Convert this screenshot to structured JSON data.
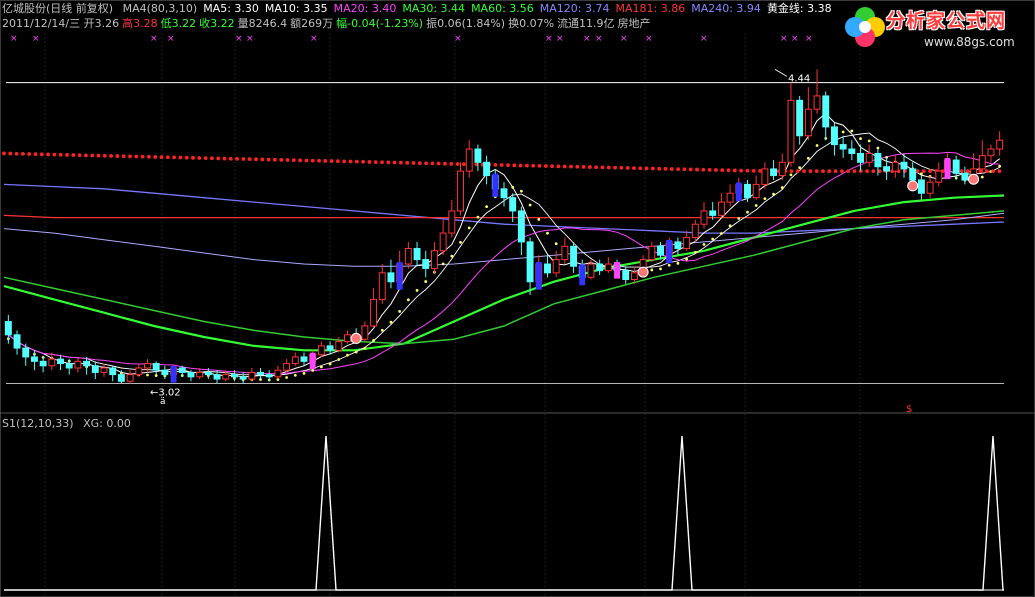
{
  "header": {
    "stock": "亿城股份(日线 前复权)",
    "indicators": [
      {
        "text": "MA4(80,3,10)",
        "color": "#c0c0c0"
      },
      {
        "text": "MA5: 3.30",
        "color": "#ffffff"
      },
      {
        "text": "MA10: 3.35",
        "color": "#ffffff"
      },
      {
        "text": "MA20: 3.40",
        "color": "#ff44ff"
      },
      {
        "text": "MA30: 3.44",
        "color": "#33ff33"
      },
      {
        "text": "MA60: 3.56",
        "color": "#33ff33"
      },
      {
        "text": "MA120: 3.74",
        "color": "#8888ff"
      },
      {
        "text": "MA181: 3.86",
        "color": "#ff3333"
      },
      {
        "text": "MA240: 3.94",
        "color": "#8888ff"
      },
      {
        "text": "黄金线: 3.38",
        "color": "#ffffff"
      }
    ],
    "quote_date": "2011/12/14/三",
    "quote": [
      {
        "text": "开3.26",
        "color": "#c0c0c0"
      },
      {
        "text": "高3.28",
        "color": "#ff3333"
      },
      {
        "text": "低3.22",
        "color": "#33ff33"
      },
      {
        "text": "收3.22",
        "color": "#33ff33"
      },
      {
        "text": "量8246.4",
        "color": "#c0c0c0"
      },
      {
        "text": "额269万",
        "color": "#c0c0c0"
      },
      {
        "text": "幅-0.04(-1.23%)",
        "color": "#33ff33"
      },
      {
        "text": "振0.06(1.84%)",
        "color": "#c0c0c0"
      },
      {
        "text": "换0.07%",
        "color": "#c0c0c0"
      },
      {
        "text": "流通11.9亿",
        "color": "#c0c0c0"
      },
      {
        "text": "房地产",
        "color": "#c0c0c0"
      }
    ]
  },
  "sub_header": {
    "formula": "S1(12,10,33)",
    "xg": "XG: 0.00"
  },
  "logo": {
    "brand": "分析家公式网",
    "url": "www.88gs.com"
  },
  "colors": {
    "up": "#ff3333",
    "down": "#54ffff",
    "buy": "#ff44ff",
    "sell": "#3333ff",
    "dots": "#ff2222",
    "gold": "#ffff66"
  },
  "chart_data": {
    "type": "candlestick",
    "ylim": [
      2.9,
      4.6
    ],
    "high_label": "4.44",
    "low_label": "3.02",
    "ma_labels": [
      "MA5",
      "MA10",
      "MA20",
      "MA30",
      "MA60",
      "MA120",
      "MA181",
      "MA240",
      "黄金线"
    ],
    "candles": [
      [
        3.3,
        3.24,
        3.33,
        3.2
      ],
      [
        3.24,
        3.18,
        3.26,
        3.15
      ],
      [
        3.18,
        3.14,
        3.2,
        3.1
      ],
      [
        3.14,
        3.12,
        3.17,
        3.08
      ],
      [
        3.12,
        3.1,
        3.14,
        3.07
      ],
      [
        3.1,
        3.13,
        3.16,
        3.08
      ],
      [
        3.13,
        3.11,
        3.15,
        3.08
      ],
      [
        3.11,
        3.09,
        3.13,
        3.06
      ],
      [
        3.09,
        3.12,
        3.14,
        3.07
      ],
      [
        3.12,
        3.1,
        3.14,
        3.06
      ],
      [
        3.1,
        3.07,
        3.12,
        3.04
      ],
      [
        3.07,
        3.09,
        3.11,
        3.05
      ],
      [
        3.09,
        3.06,
        3.1,
        3.03
      ],
      [
        3.06,
        3.03,
        3.08,
        3.02
      ],
      [
        3.03,
        3.06,
        3.08,
        3.02
      ],
      [
        3.06,
        3.09,
        3.11,
        3.05
      ],
      [
        3.09,
        3.11,
        3.13,
        3.07
      ],
      [
        3.11,
        3.08,
        3.12,
        3.06
      ],
      [
        3.08,
        3.06,
        3.1,
        3.04
      ],
      [
        3.06,
        3.09,
        3.1,
        3.05
      ],
      [
        3.09,
        3.07,
        3.1,
        3.05
      ],
      [
        3.07,
        3.05,
        3.08,
        3.03
      ],
      [
        3.05,
        3.07,
        3.09,
        3.04
      ],
      [
        3.07,
        3.06,
        3.09,
        3.04
      ],
      [
        3.06,
        3.04,
        3.08,
        3.02
      ],
      [
        3.04,
        3.06,
        3.08,
        3.03
      ],
      [
        3.06,
        3.05,
        3.08,
        3.03
      ],
      [
        3.05,
        3.04,
        3.07,
        3.02
      ],
      [
        3.04,
        3.07,
        3.09,
        3.03
      ],
      [
        3.07,
        3.06,
        3.09,
        3.04
      ],
      [
        3.06,
        3.05,
        3.08,
        3.03
      ],
      [
        3.05,
        3.08,
        3.1,
        3.04
      ],
      [
        3.08,
        3.11,
        3.13,
        3.07
      ],
      [
        3.11,
        3.14,
        3.16,
        3.1
      ],
      [
        3.14,
        3.12,
        3.16,
        3.1
      ],
      [
        3.12,
        3.15,
        3.17,
        3.11
      ],
      [
        3.15,
        3.19,
        3.21,
        3.14
      ],
      [
        3.19,
        3.17,
        3.21,
        3.15
      ],
      [
        3.17,
        3.21,
        3.23,
        3.16
      ],
      [
        3.21,
        3.24,
        3.26,
        3.2
      ],
      [
        3.24,
        3.22,
        3.27,
        3.21
      ],
      [
        3.22,
        3.28,
        3.3,
        3.21
      ],
      [
        3.28,
        3.4,
        3.45,
        3.27
      ],
      [
        3.4,
        3.52,
        3.56,
        3.38
      ],
      [
        3.52,
        3.48,
        3.58,
        3.45
      ],
      [
        3.48,
        3.56,
        3.62,
        3.46
      ],
      [
        3.56,
        3.63,
        3.66,
        3.54
      ],
      [
        3.63,
        3.58,
        3.66,
        3.55
      ],
      [
        3.58,
        3.54,
        3.62,
        3.5
      ],
      [
        3.54,
        3.62,
        3.66,
        3.52
      ],
      [
        3.62,
        3.7,
        3.76,
        3.6
      ],
      [
        3.7,
        3.8,
        3.85,
        3.68
      ],
      [
        3.8,
        3.98,
        4.02,
        3.78
      ],
      [
        3.98,
        4.08,
        4.12,
        3.95
      ],
      [
        4.08,
        4.02,
        4.1,
        3.98
      ],
      [
        4.02,
        3.96,
        4.05,
        3.92
      ],
      [
        3.96,
        3.9,
        3.99,
        3.86
      ],
      [
        3.9,
        3.86,
        3.93,
        3.82
      ],
      [
        3.86,
        3.8,
        3.88,
        3.75
      ],
      [
        3.8,
        3.66,
        3.82,
        3.6
      ],
      [
        3.66,
        3.48,
        3.68,
        3.42
      ],
      [
        3.48,
        3.56,
        3.6,
        3.46
      ],
      [
        3.56,
        3.52,
        3.6,
        3.5
      ],
      [
        3.52,
        3.58,
        3.62,
        3.5
      ],
      [
        3.58,
        3.64,
        3.68,
        3.56
      ],
      [
        3.64,
        3.55,
        3.66,
        3.52
      ],
      [
        3.55,
        3.5,
        3.58,
        3.48
      ],
      [
        3.5,
        3.56,
        3.58,
        3.49
      ],
      [
        3.56,
        3.53,
        3.58,
        3.51
      ],
      [
        3.53,
        3.56,
        3.59,
        3.52
      ],
      [
        3.56,
        3.53,
        3.58,
        3.51
      ],
      [
        3.53,
        3.49,
        3.55,
        3.47
      ],
      [
        3.49,
        3.52,
        3.55,
        3.47
      ],
      [
        3.52,
        3.58,
        3.6,
        3.51
      ],
      [
        3.58,
        3.64,
        3.66,
        3.57
      ],
      [
        3.64,
        3.6,
        3.66,
        3.58
      ],
      [
        3.6,
        3.66,
        3.68,
        3.59
      ],
      [
        3.66,
        3.63,
        3.68,
        3.6
      ],
      [
        3.63,
        3.68,
        3.71,
        3.62
      ],
      [
        3.68,
        3.74,
        3.76,
        3.66
      ],
      [
        3.74,
        3.8,
        3.84,
        3.72
      ],
      [
        3.8,
        3.78,
        3.84,
        3.76
      ],
      [
        3.78,
        3.84,
        3.88,
        3.77
      ],
      [
        3.84,
        3.88,
        3.92,
        3.82
      ],
      [
        3.88,
        3.92,
        3.95,
        3.86
      ],
      [
        3.92,
        3.86,
        3.94,
        3.84
      ],
      [
        3.86,
        3.92,
        3.96,
        3.85
      ],
      [
        3.92,
        3.99,
        4.02,
        3.9
      ],
      [
        3.99,
        3.96,
        4.03,
        3.94
      ],
      [
        3.96,
        4.02,
        4.06,
        3.94
      ],
      [
        4.02,
        4.3,
        4.38,
        4.0
      ],
      [
        4.3,
        4.14,
        4.32,
        4.1
      ],
      [
        4.14,
        4.26,
        4.36,
        4.12
      ],
      [
        4.26,
        4.32,
        4.44,
        4.24
      ],
      [
        4.32,
        4.18,
        4.34,
        4.12
      ],
      [
        4.18,
        4.1,
        4.2,
        4.05
      ],
      [
        4.1,
        4.08,
        4.14,
        4.04
      ],
      [
        4.08,
        4.06,
        4.12,
        4.03
      ],
      [
        4.06,
        4.02,
        4.1,
        3.98
      ],
      [
        4.02,
        4.06,
        4.1,
        4.0
      ],
      [
        4.06,
        4.0,
        4.08,
        3.96
      ],
      [
        4.0,
        3.98,
        4.04,
        3.94
      ],
      [
        3.98,
        4.02,
        4.05,
        3.95
      ],
      [
        4.02,
        3.99,
        4.06,
        3.95
      ],
      [
        3.99,
        3.94,
        4.02,
        3.9
      ],
      [
        3.94,
        3.88,
        3.96,
        3.85
      ],
      [
        3.88,
        3.93,
        3.96,
        3.86
      ],
      [
        3.93,
        3.98,
        4.02,
        3.91
      ],
      [
        3.98,
        4.03,
        4.06,
        3.96
      ],
      [
        4.03,
        3.97,
        4.05,
        3.94
      ],
      [
        3.97,
        3.94,
        4.0,
        3.92
      ],
      [
        3.94,
        3.99,
        4.06,
        3.93
      ],
      [
        3.99,
        4.05,
        4.12,
        3.97
      ],
      [
        4.05,
        4.08,
        4.1,
        4.02
      ],
      [
        4.08,
        4.12,
        4.16,
        4.05
      ]
    ],
    "upper_dots": [
      4.06,
      3.98
    ],
    "upper_line": 4.38,
    "lower_line": 3.02,
    "ma_series": {
      "MA120": [
        3.92,
        3.91,
        3.9,
        3.88,
        3.86,
        3.84,
        3.82,
        3.8,
        3.78,
        3.76,
        3.74,
        3.73,
        3.72,
        3.71,
        3.7,
        3.7,
        3.71,
        3.72,
        3.73,
        3.74,
        3.75
      ],
      "MA181": [
        3.78,
        3.77,
        3.77,
        3.77,
        3.77,
        3.77,
        3.77,
        3.77,
        3.77,
        3.77,
        3.77,
        3.77,
        3.77,
        3.77,
        3.77,
        3.77,
        3.77,
        3.77,
        3.77,
        3.77,
        3.77
      ],
      "MA240": [
        3.72,
        3.7,
        3.67,
        3.64,
        3.61,
        3.58,
        3.56,
        3.55,
        3.55,
        3.56,
        3.58,
        3.6,
        3.62,
        3.64,
        3.66,
        3.68,
        3.7,
        3.72,
        3.74,
        3.76,
        3.79
      ],
      "MA30": [
        3.46,
        3.4,
        3.34,
        3.28,
        3.23,
        3.19,
        3.17,
        3.17,
        3.2,
        3.3,
        3.4,
        3.48,
        3.54,
        3.58,
        3.62,
        3.68,
        3.74,
        3.8,
        3.84,
        3.86,
        3.87
      ],
      "MA60": [
        3.5,
        3.45,
        3.4,
        3.35,
        3.3,
        3.26,
        3.23,
        3.21,
        3.2,
        3.22,
        3.28,
        3.38,
        3.44,
        3.5,
        3.55,
        3.6,
        3.66,
        3.72,
        3.76,
        3.78,
        3.8
      ]
    },
    "volume_peaks": [
      {
        "index": 0,
        "value": 100
      },
      {
        "index": 0,
        "value": 100
      },
      {
        "index": 0,
        "value": 100
      }
    ]
  }
}
